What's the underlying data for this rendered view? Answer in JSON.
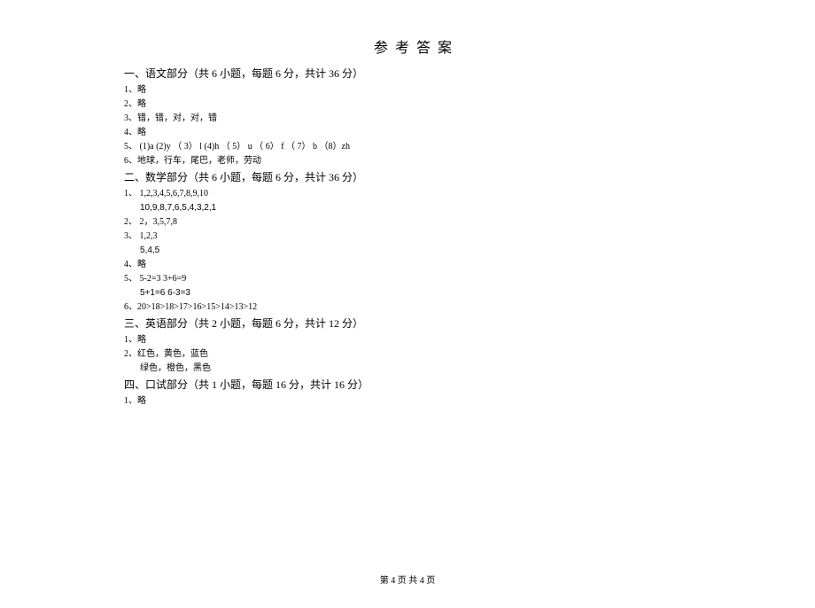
{
  "title": "参考答案",
  "sections": [
    {
      "header": "一、语文部分（共  6 小题，每题  6 分，共计 36 分）",
      "lines": [
        {
          "indent": false,
          "text": "1、略"
        },
        {
          "indent": false,
          "text": "2、略"
        },
        {
          "indent": false,
          "text": "3、错，错，对，对，错"
        },
        {
          "indent": false,
          "text": "4、略"
        },
        {
          "indent": false,
          "text": "5、 (1)a (2)y      （ 3） l (4)h     （ 5） u （ 6） f      （ 7） b  （8）zh"
        },
        {
          "indent": false,
          "text": "6、地球，行车，尾巴，老师，劳动"
        }
      ]
    },
    {
      "header": "二、数学部分（共  6 小题，每题  6 分，共计 36 分）",
      "lines": [
        {
          "indent": false,
          "text": "1、 1,2,3,4,5,6,7,8,9,10"
        },
        {
          "indent": true,
          "text": "10,9,8,7,6,5,4,3,2,1"
        },
        {
          "indent": false,
          "text": "2、 2，3,5,7,8"
        },
        {
          "indent": false,
          "text": "3、 1,2,3"
        },
        {
          "indent": true,
          "text": "5,4,5"
        },
        {
          "indent": false,
          "text": "4、略"
        },
        {
          "indent": false,
          "text": "5、 5-2=3   3+6=9"
        },
        {
          "indent": true,
          "text": "5+1=6   6-3=3"
        },
        {
          "indent": false,
          "text": "6、20>18>18>17>16>15>14>13>12"
        }
      ]
    },
    {
      "header": "三、英语部分（共  2 小题，每题  6 分，共计 12 分）",
      "lines": [
        {
          "indent": false,
          "text": "1、略"
        },
        {
          "indent": false,
          "text": " 2、红色，黄色，蓝色"
        },
        {
          "indent": true,
          "text": "绿色，橙色，黑色"
        }
      ]
    },
    {
      "header": "四、口试部分（共  1 小题，每题  16 分，共计  16 分）",
      "lines": [
        {
          "indent": false,
          "text": "1、略"
        }
      ]
    }
  ],
  "footer": "第 4 页      共 4 页"
}
